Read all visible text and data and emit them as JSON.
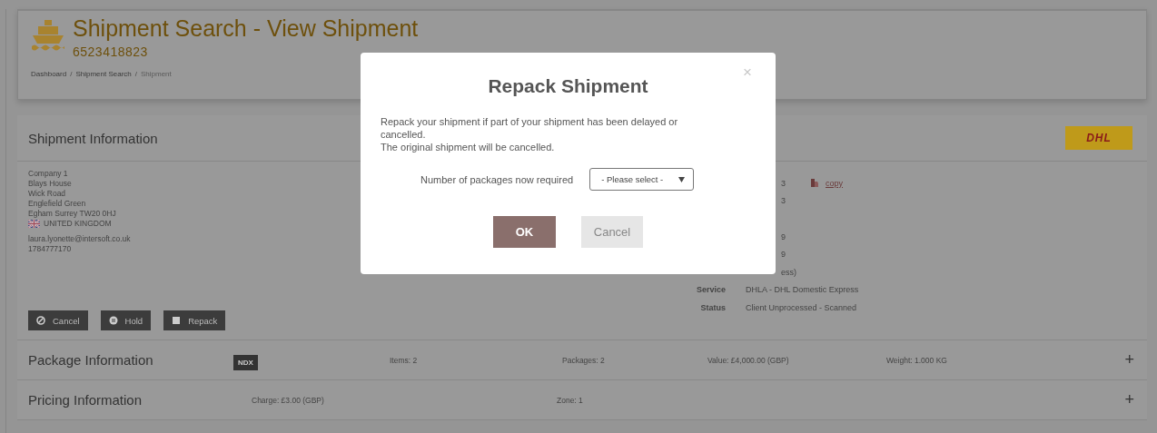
{
  "header": {
    "title": "Shipment Search - View Shipment",
    "shipment_number": "6523418823",
    "breadcrumb": [
      {
        "label": "Dashboard",
        "current": false
      },
      {
        "label": "Shipment Search",
        "current": false
      },
      {
        "label": "Shipment",
        "current": true
      }
    ],
    "separator": "/"
  },
  "shipment_info": {
    "title": "Shipment Information",
    "carrier_logo": "DHL",
    "address_lines": [
      "Company 1",
      "Blays House",
      "Wick Road",
      "Englefield Green",
      "Egham Surrey TW20 0HJ"
    ],
    "country": "UNITED KINGDOM",
    "email": "laura.lyonette@intersoft.co.uk",
    "phone": "1784777170",
    "actions": [
      {
        "label": "Cancel",
        "kind": "cancel"
      },
      {
        "label": "Hold",
        "kind": "hold"
      },
      {
        "label": "Repack",
        "kind": "repack"
      }
    ],
    "details": [
      {
        "value": "3",
        "link": "copy"
      },
      {
        "value": "3"
      },
      {
        "value": "9"
      },
      {
        "value": "9"
      },
      {
        "value": "ess)"
      },
      {
        "label": "Service",
        "value": "DHLA - DHL Domestic Express"
      },
      {
        "label": "Status",
        "value": "Client Unprocessed - Scanned"
      }
    ]
  },
  "sections": [
    {
      "kind": "package",
      "title": "Package Information",
      "badge": "NDX",
      "fields": [
        "Items: 2",
        "Packages: 2",
        "Value: £4,000.00 (GBP)",
        "Weight: 1.000 KG"
      ],
      "toggle": "+"
    },
    {
      "kind": "pricing",
      "title": "Pricing Information",
      "fields": [
        "Charge: £3.00 (GBP)",
        "Zone: 1"
      ],
      "toggle": "+"
    }
  ],
  "modal": {
    "title": "Repack Shipment",
    "close": "×",
    "message": [
      "Repack your shipment if part of your shipment has been delayed or cancelled.",
      "The original shipment will be cancelled."
    ],
    "field_label": "Number of packages now required",
    "select_placeholder": "- Please select -",
    "buttons": [
      {
        "label": "OK",
        "kind": "primary"
      },
      {
        "label": "Cancel",
        "kind": "secondary"
      }
    ]
  }
}
